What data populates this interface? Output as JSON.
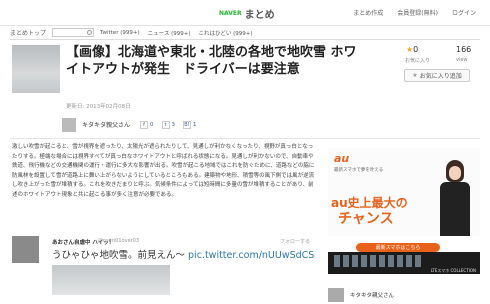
{
  "header": {
    "logo_naver": "NAVER",
    "logo_matome": "まとめ",
    "links": [
      "まとめ作成",
      "会員登録(無料)",
      "ログイン"
    ]
  },
  "subnav": {
    "home": "まとめトップ",
    "tabs": [
      "Twitter (999+)",
      "ニュース (999+)",
      "これはひどい (999+)"
    ]
  },
  "article": {
    "title": "【画像】北海道や東北・北陸の各地で地吹雪 ホワイトアウトが発生　ドライバーは要注意",
    "date": "更新日: 2013年02月08日"
  },
  "stats": {
    "favorites": "0",
    "favorites_label": "お気に入り",
    "views": "166",
    "views_label": "view",
    "fav_button": "お気に入り追加"
  },
  "author": {
    "name": "キタキタ親父さん",
    "facebook": "0",
    "twitter": "3",
    "hatena": "1"
  },
  "body": {
    "paragraph": "激しい吹雪が起こると、雪が視界を遮ったり、太陽光が遮られたりして、見通しが利かなくなったり、視野が真っ白となったりする。極端な場合には視界すべてが真っ白なホワイトアウトと呼ばれる状態になる。見通しが利かないので、自動車や鉄道、飛行機などの交通機関の運行・運行に多大な影響が出る。吹雪が起こる地域ではこれを防ぐために、道路などの脇に防風林を設置して雪が道路上に舞い上がらないようにしているところもある。建築物や地形、積雪等の風下側では風が逆流し吹き上がった雪が堆積する。これを吹きだまりと呼ぶ。気候条件によっては短時間に多量の雪が堆積することがあり、前述のホワイトアウト現象と共に起こる事が多く注意が必要である。"
  },
  "tweet": {
    "name": "あおさん自虐中 ハイッ！",
    "handle": "@oseri01over03",
    "follow": "フォローする",
    "text": "うひゃひゃ地吹雪。前見えん〜 ",
    "link": "pic.twitter.com/nUUwSdCS"
  },
  "ad": {
    "brand": "au",
    "lead": "最新スマホで夢を叶える",
    "headline": "au史上最大の",
    "headline2": "チャンス",
    "cta": "最新スマホはこちら",
    "footer": "LTEスマホ COLLECTION",
    "accent_color": "#e8621c"
  },
  "sidebar_author": {
    "name": "キタキタ親父さん"
  }
}
